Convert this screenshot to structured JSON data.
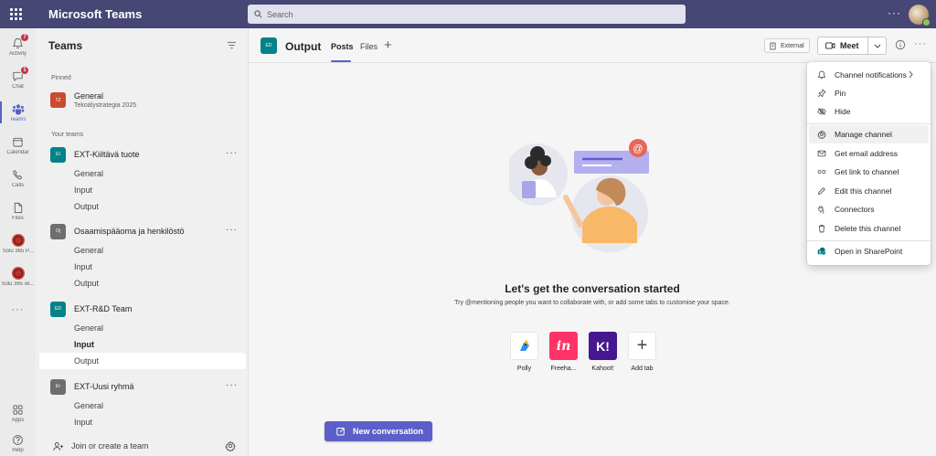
{
  "titlebar": {
    "app_title": "Microsoft Teams",
    "search_placeholder": "Search",
    "more_label": "···"
  },
  "rail": {
    "items": [
      {
        "label": "Activity",
        "badge": "7"
      },
      {
        "label": "Chat",
        "badge": "1"
      },
      {
        "label": "Teams"
      },
      {
        "label": "Calendar"
      },
      {
        "label": "Calls"
      },
      {
        "label": "Files"
      },
      {
        "label": "Solu 365 P..."
      },
      {
        "label": "Solu 365 wi..."
      },
      {
        "label": "···"
      },
      {
        "label": "Apps"
      },
      {
        "label": "Help"
      }
    ]
  },
  "panel": {
    "title": "Teams",
    "pinned_label": "Pinned",
    "pinned": {
      "initials": "TZ",
      "name": "General",
      "subtitle": "Tekoälystrategia 2025",
      "color": "#cc4a31"
    },
    "your_teams_label": "Your teams",
    "teams": [
      {
        "initials": "EI",
        "name": "EXT-Kiiltävä tuote",
        "color": "#038387",
        "channels": [
          "General",
          "Input",
          "Output"
        ]
      },
      {
        "initials": "Oj",
        "name": "Osaamispääoma ja henkilöstö",
        "color": "#6e6e6e",
        "channels": [
          "General",
          "Input",
          "Output"
        ]
      },
      {
        "initials": "ED",
        "name": "EXT-R&D Team",
        "color": "#038387",
        "channels": [
          "General",
          "Input",
          "Output"
        ]
      },
      {
        "initials": "Er",
        "name": "EXT-Uusi ryhmä",
        "color": "#6e6e6e",
        "channels": [
          "General",
          "Input"
        ]
      }
    ],
    "join_label": "Join or create a team",
    "team_more": "···"
  },
  "channel_header": {
    "initials": "ED",
    "name": "Output",
    "tabs": [
      "Posts",
      "Files"
    ],
    "external_label": "External",
    "meet_label": "Meet",
    "more_label": "···"
  },
  "empty_state": {
    "title": "Let's get the conversation started",
    "subtitle": "Try @mentioning people you want to collaborate with, or add some tabs to customise your space."
  },
  "apps": [
    {
      "label": "Polly",
      "glyph": "",
      "color": "#ffffff"
    },
    {
      "label": "Freeha...",
      "glyph": "in",
      "color": "#ff3366"
    },
    {
      "label": "Kahoot!",
      "glyph": "K!",
      "color": "#46178f"
    },
    {
      "label": "Add tab",
      "glyph": "+",
      "color": "#ffffff"
    }
  ],
  "new_conversation_label": "New conversation",
  "context_menu": {
    "items": [
      {
        "label": "Channel notifications",
        "icon": "bell-icon"
      },
      {
        "label": "Pin",
        "icon": "pin-icon"
      },
      {
        "label": "Hide",
        "icon": "eye-off-icon"
      },
      {
        "label": "Manage channel",
        "icon": "gear-icon"
      },
      {
        "label": "Get email address",
        "icon": "mail-icon"
      },
      {
        "label": "Get link to channel",
        "icon": "link-icon"
      },
      {
        "label": "Edit this channel",
        "icon": "pencil-icon"
      },
      {
        "label": "Connectors",
        "icon": "plug-icon"
      },
      {
        "label": "Delete this channel",
        "icon": "trash-icon"
      },
      {
        "label": "Open in SharePoint",
        "icon": "sharepoint-icon"
      }
    ]
  },
  "colors": {
    "titlebar": "#464775",
    "accent": "#5b5fc7",
    "badge": "#c4314b",
    "presence": "#92c353"
  }
}
